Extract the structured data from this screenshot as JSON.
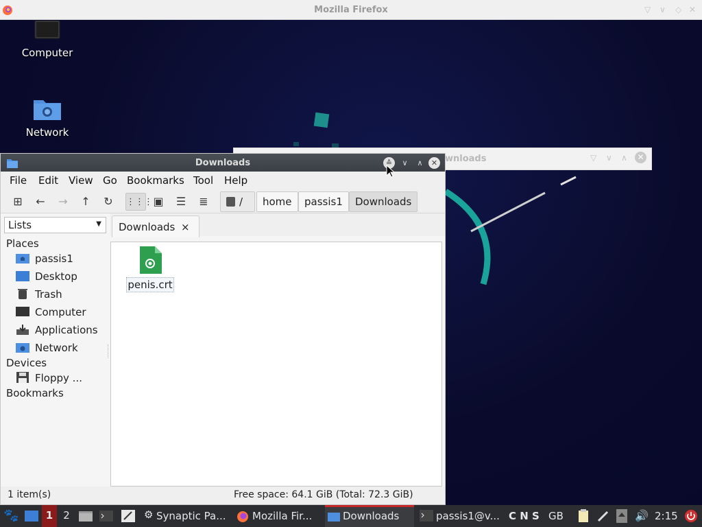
{
  "firefox_bar": {
    "title": "Mozilla Firefox"
  },
  "desktop": {
    "icons": [
      {
        "label": "Computer",
        "icon": "computer-icon"
      },
      {
        "label": "Network",
        "icon": "network-folder-icon"
      }
    ]
  },
  "background_window": {
    "title": "Downloads",
    "visible_title": "wnloads"
  },
  "window": {
    "title": "Downloads",
    "menu": [
      "File",
      "Edit",
      "View",
      "Go",
      "Bookmarks",
      "Tool",
      "Help"
    ],
    "breadcrumb": [
      "/",
      "home",
      "passis1",
      "Downloads"
    ],
    "side_selector": "Lists",
    "places_heading": "Places",
    "places": [
      {
        "label": "passis1",
        "icon": "home-folder-icon"
      },
      {
        "label": "Desktop",
        "icon": "desktop-icon"
      },
      {
        "label": "Trash",
        "icon": "trash-icon"
      },
      {
        "label": "Computer",
        "icon": "computer-icon"
      },
      {
        "label": "Applications",
        "icon": "applications-icon"
      },
      {
        "label": "Network",
        "icon": "network-folder-icon"
      }
    ],
    "devices_heading": "Devices",
    "devices": [
      {
        "label": "Floppy ...",
        "icon": "floppy-icon"
      }
    ],
    "bookmarks_heading": "Bookmarks",
    "tab_label": "Downloads",
    "tab_close": "×",
    "files": [
      {
        "name": "penis.crt",
        "icon": "certificate-file-icon"
      }
    ],
    "status_left": "1 item(s)",
    "status_right": "Free space: 64.1 GiB (Total: 72.3 GiB)"
  },
  "taskbar": {
    "workspaces": [
      "1",
      "2"
    ],
    "tasks": [
      {
        "label": "Synaptic Pa..."
      },
      {
        "label": "Mozilla Fir..."
      },
      {
        "label": "Downloads"
      },
      {
        "label": "passis1@v..."
      }
    ],
    "indicators": "C N S",
    "keyboard": "GB",
    "clock": "2:15"
  },
  "colors": {
    "accent_active_task": "#c62828",
    "workspace_active": "#8b1a1a",
    "file_green": "#2e9e4f"
  }
}
